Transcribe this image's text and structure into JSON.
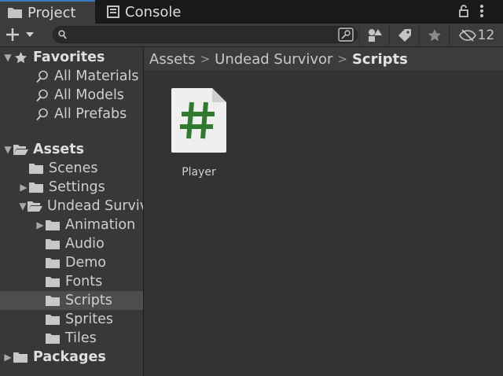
{
  "tabs": [
    {
      "label": "Project",
      "icon": "folder-icon",
      "active": true
    },
    {
      "label": "Console",
      "icon": "console-icon",
      "active": false
    }
  ],
  "toolbar": {
    "search_placeholder": "",
    "hidden_count": "12"
  },
  "breadcrumb": [
    "Assets",
    "Undead Survivor",
    "Scripts"
  ],
  "sidebar": {
    "favorites": {
      "label": "Favorites",
      "items": [
        "All Materials",
        "All Models",
        "All Prefabs"
      ]
    },
    "assets": {
      "label": "Assets",
      "items": [
        {
          "label": "Scenes"
        },
        {
          "label": "Settings"
        },
        {
          "label": "Undead Survivor",
          "children": [
            "Animation",
            "Audio",
            "Demo",
            "Fonts",
            "Scripts",
            "Sprites",
            "Tiles"
          ]
        }
      ]
    },
    "packages": {
      "label": "Packages"
    },
    "selected": "Scripts"
  },
  "content": {
    "assets": [
      {
        "name": "Player",
        "icon": "csharp-script-icon"
      }
    ]
  },
  "colors": {
    "accent": "#3a79bb",
    "script_hash": "#2f7a2f",
    "selected_row": "#4d4d4d"
  }
}
